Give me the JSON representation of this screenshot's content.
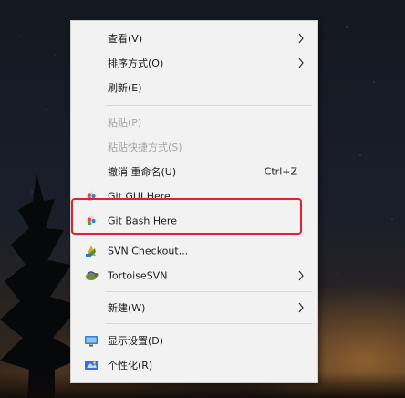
{
  "menu": {
    "items": [
      {
        "label": "查看(V)",
        "has_submenu": true,
        "enabled": true
      },
      {
        "label": "排序方式(O)",
        "has_submenu": true,
        "enabled": true
      },
      {
        "label": "刷新(E)",
        "has_submenu": false,
        "enabled": true
      },
      {
        "label": "粘贴(P)",
        "has_submenu": false,
        "enabled": false
      },
      {
        "label": "粘贴快捷方式(S)",
        "has_submenu": false,
        "enabled": false
      },
      {
        "label": "撤消 重命名(U)",
        "shortcut": "Ctrl+Z",
        "has_submenu": false,
        "enabled": true
      },
      {
        "label": "Git GUI Here",
        "icon": "git-gui-icon",
        "has_submenu": false,
        "enabled": true
      },
      {
        "label": "Git Bash Here",
        "icon": "git-bash-icon",
        "has_submenu": false,
        "enabled": true
      },
      {
        "label": "SVN Checkout...",
        "icon": "svn-checkout-icon",
        "has_submenu": false,
        "enabled": true
      },
      {
        "label": "TortoiseSVN",
        "icon": "tortoisesvn-icon",
        "has_submenu": true,
        "enabled": true
      },
      {
        "label": "新建(W)",
        "has_submenu": true,
        "enabled": true
      },
      {
        "label": "显示设置(D)",
        "icon": "display-settings-icon",
        "has_submenu": false,
        "enabled": true
      },
      {
        "label": "个性化(R)",
        "icon": "personalize-icon",
        "has_submenu": false,
        "enabled": true
      }
    ]
  },
  "annotation": {
    "highlighted_item": "Git Bash Here",
    "color": "#e5202e"
  },
  "colors": {
    "menu_bg": "#f2f2f2",
    "disabled_text": "#a3a3a3",
    "highlight_border": "#e5202e"
  }
}
